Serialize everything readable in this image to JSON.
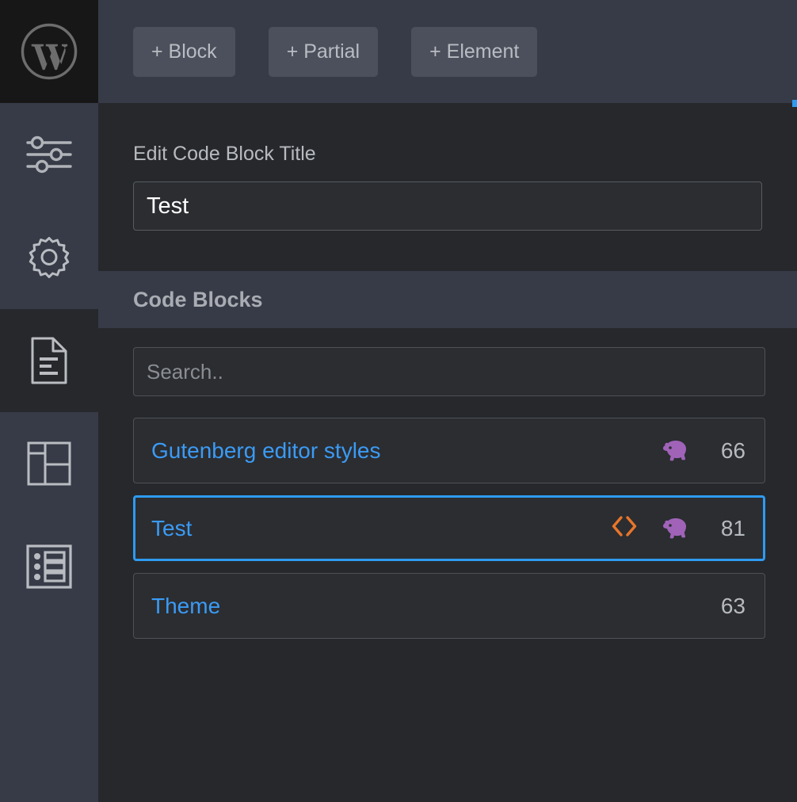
{
  "sidebar": {
    "logo": {
      "icon": "wordpress-logo-icon",
      "label": "WordPress"
    },
    "items": [
      {
        "icon": "sliders-icon",
        "label": "Customizer Controls",
        "active": false
      },
      {
        "icon": "gear-icon",
        "label": "Settings",
        "active": false
      },
      {
        "icon": "document-icon",
        "label": "Code Blocks",
        "active": true
      },
      {
        "icon": "layout-icon",
        "label": "Layouts",
        "active": false
      },
      {
        "icon": "list-icon",
        "label": "List",
        "active": false
      }
    ]
  },
  "toolbar": {
    "buttons": [
      {
        "label": "+ Block",
        "name": "add-block-button"
      },
      {
        "label": "+ Partial",
        "name": "add-partial-button"
      },
      {
        "label": "+ Element",
        "name": "add-element-button"
      }
    ]
  },
  "edit_panel": {
    "label": "Edit Code Block Title",
    "title_value": "Test",
    "title_placeholder": ""
  },
  "code_blocks": {
    "header": "Code Blocks",
    "search_placeholder": "Search..",
    "search_value": "",
    "items": [
      {
        "title": "Gutenberg editor styles",
        "count": "66",
        "selected": false,
        "icons": [
          "php-elephant-icon"
        ]
      },
      {
        "title": "Test",
        "count": "81",
        "selected": true,
        "icons": [
          "code-brackets-icon",
          "php-elephant-icon"
        ]
      },
      {
        "title": "Theme",
        "count": "63",
        "selected": false,
        "icons": []
      }
    ]
  },
  "colors": {
    "accent_blue": "#2e9bf0",
    "link_blue": "#3b9bf5",
    "code_orange": "#e8752a",
    "php_purple": "#a濾"
  }
}
